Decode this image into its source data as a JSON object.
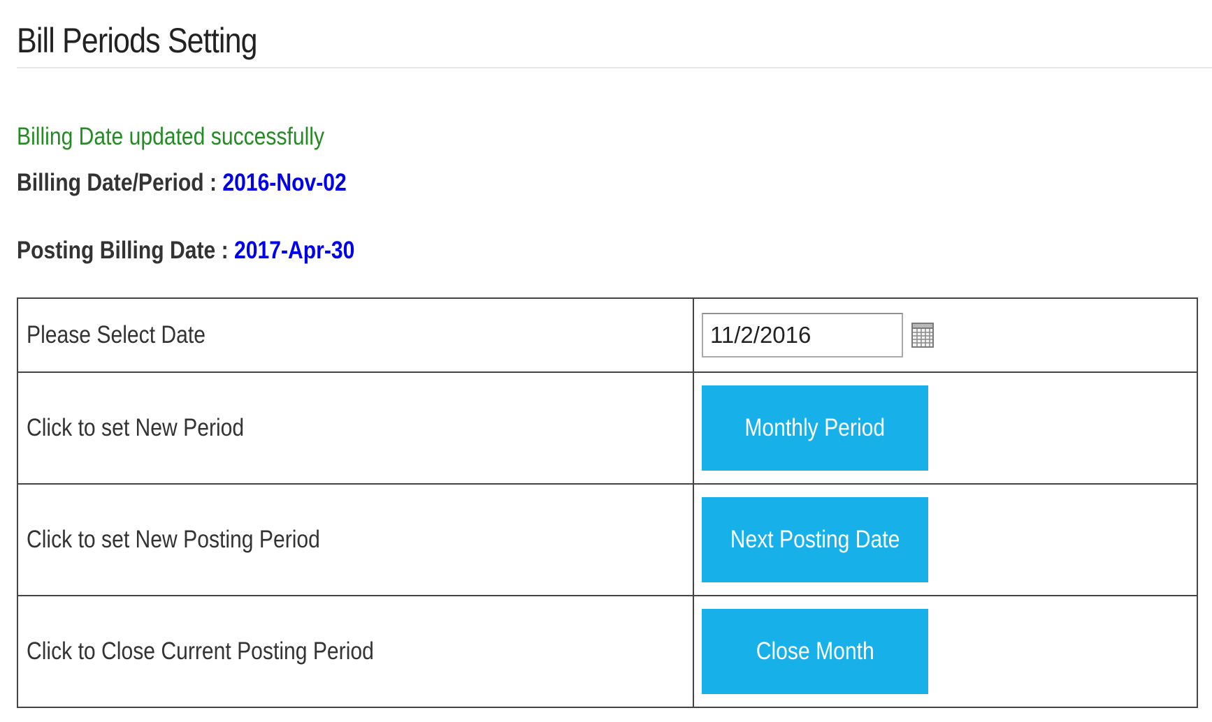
{
  "page": {
    "title": "Bill Periods Setting"
  },
  "status": {
    "message": "Billing Date updated successfully",
    "message_color": "#228b22"
  },
  "billing": {
    "label": "Billing Date/Period : ",
    "value": "2016-Nov-02"
  },
  "posting": {
    "label": "Posting Billing Date : ",
    "value": "2017-Apr-30"
  },
  "table": {
    "rows": [
      {
        "label": "Please Select Date",
        "control": "date",
        "date_value": "11/2/2016",
        "icon": "calendar-icon"
      },
      {
        "label": "Click to set New Period",
        "control": "button",
        "button_label": "Monthly Period"
      },
      {
        "label": "Click to set New Posting Period",
        "control": "button",
        "button_label": "Next Posting Date"
      },
      {
        "label": "Click to Close Current Posting Period",
        "control": "button",
        "button_label": "Close Month"
      }
    ]
  },
  "colors": {
    "accent_button": "#17b0e8",
    "value_link": "#0000ee",
    "table_border": "#444444"
  }
}
